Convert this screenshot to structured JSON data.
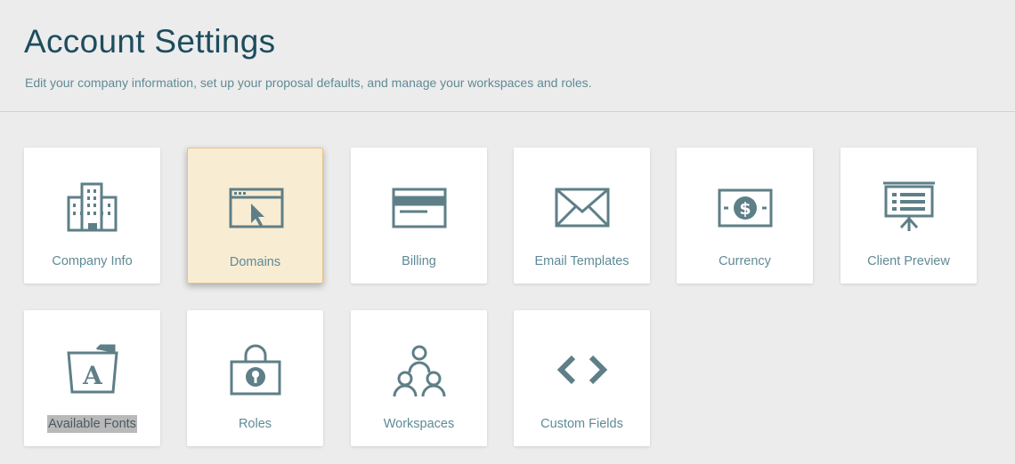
{
  "header": {
    "title": "Account Settings",
    "subtitle": "Edit your company information, set up your proposal defaults, and manage your workspaces and roles."
  },
  "cards": [
    {
      "label": "Company Info",
      "icon": "building-icon"
    },
    {
      "label": "Domains",
      "icon": "browser-cursor-icon",
      "state": "hovered"
    },
    {
      "label": "Billing",
      "icon": "credit-card-icon"
    },
    {
      "label": "Email Templates",
      "icon": "envelope-icon"
    },
    {
      "label": "Currency",
      "icon": "dollar-bill-icon"
    },
    {
      "label": "Client Preview",
      "icon": "presentation-board-icon"
    },
    {
      "label": "Available Fonts",
      "icon": "font-folder-icon",
      "state": "text-selected"
    },
    {
      "label": "Roles",
      "icon": "padlock-icon"
    },
    {
      "label": "Workspaces",
      "icon": "people-group-icon"
    },
    {
      "label": "Custom Fields",
      "icon": "code-brackets-icon"
    }
  ],
  "colors": {
    "background": "#ececec",
    "title": "#1d4d5e",
    "text": "#5f8a96",
    "icon": "#5e7f87",
    "hover_card": "#f8ecd3"
  }
}
